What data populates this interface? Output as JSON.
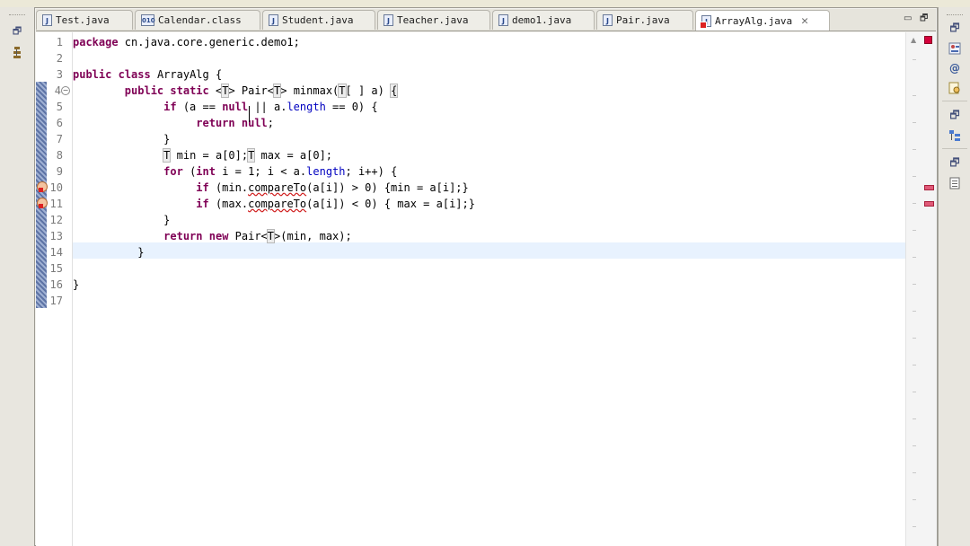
{
  "editor": {
    "tabs": [
      {
        "label": "Test.java",
        "icon": "java-file-icon",
        "active": false
      },
      {
        "label": "Calendar.class",
        "icon": "class-file-icon",
        "active": false
      },
      {
        "label": "Student.java",
        "icon": "java-file-icon",
        "active": false
      },
      {
        "label": "Teacher.java",
        "icon": "java-file-icon",
        "active": false
      },
      {
        "label": "demo1.java",
        "icon": "java-file-icon",
        "active": false
      },
      {
        "label": "Pair.java",
        "icon": "java-file-icon",
        "active": false
      },
      {
        "label": "ArrayAlg.java",
        "icon": "java-file-error-icon",
        "active": true
      }
    ],
    "line_numbers": [
      "1",
      "2",
      "3",
      "4",
      "5",
      "6",
      "7",
      "8",
      "9",
      "10",
      "11",
      "12",
      "13",
      "14",
      "15",
      "16",
      "17"
    ],
    "current_line": "14",
    "error_lines": [
      "10",
      "11"
    ]
  },
  "colors": {
    "keyword": "#7f0055",
    "field": "#0000c0",
    "current_line_bg": "#e8f2fe",
    "error": "#d22222"
  },
  "icons": {
    "left_trim": [
      "restore-icon",
      "package-explorer-icon"
    ],
    "right_trim": [
      "restore-icon",
      "outline-icon",
      "javadoc-icon",
      "declaration-icon",
      "restore-icon",
      "hierarchy-icon",
      "restore-icon",
      "task-list-icon"
    ]
  }
}
